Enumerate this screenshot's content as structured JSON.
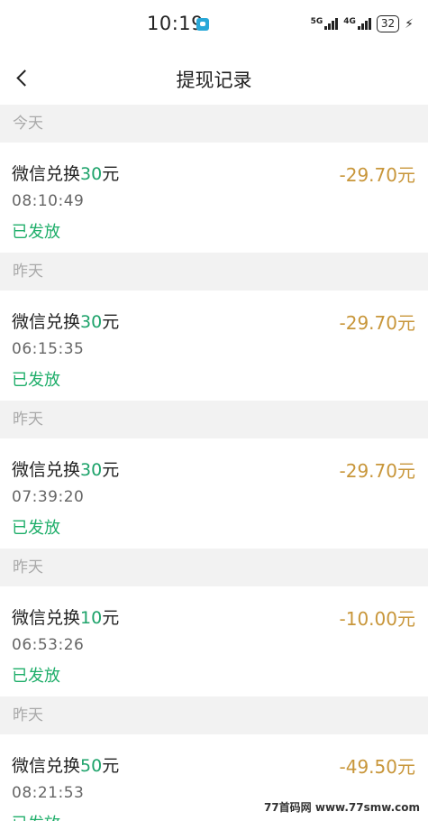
{
  "status_bar": {
    "time": "10:19",
    "net1": "5G",
    "net2": "4G",
    "battery": "32"
  },
  "nav": {
    "title": "提现记录"
  },
  "sections": [
    {
      "date": "今天",
      "record": {
        "title_prefix": "微信兑换",
        "title_amount": "30",
        "title_unit": "元",
        "time": "08:10:49",
        "status": "已发放",
        "amount": "-29.70元"
      }
    },
    {
      "date": "昨天",
      "record": {
        "title_prefix": "微信兑换",
        "title_amount": "30",
        "title_unit": "元",
        "time": "06:15:35",
        "status": "已发放",
        "amount": "-29.70元"
      }
    },
    {
      "date": "昨天",
      "record": {
        "title_prefix": "微信兑换",
        "title_amount": "30",
        "title_unit": "元",
        "time": "07:39:20",
        "status": "已发放",
        "amount": "-29.70元"
      }
    },
    {
      "date": "昨天",
      "record": {
        "title_prefix": "微信兑换",
        "title_amount": "10",
        "title_unit": "元",
        "time": "06:53:26",
        "status": "已发放",
        "amount": "-10.00元"
      }
    },
    {
      "date": "昨天",
      "record": {
        "title_prefix": "微信兑换",
        "title_amount": "50",
        "title_unit": "元",
        "time": "08:21:53",
        "status": "已发放",
        "amount": "-49.50元"
      }
    }
  ],
  "watermark": "77首码网 www.77smw.com",
  "colors": {
    "status_green": "#1fae6a",
    "amount_gold": "#c8963a",
    "header_gray": "#f2f2f2"
  }
}
